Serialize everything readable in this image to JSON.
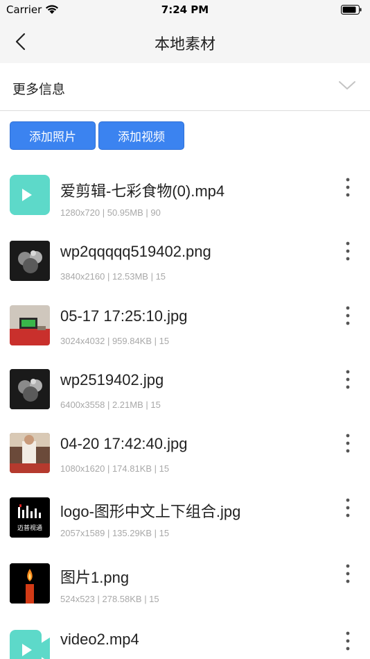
{
  "status_bar": {
    "carrier": "Carrier",
    "time": "7:24 PM"
  },
  "nav": {
    "title": "本地素材",
    "back_icon": "chevron-left-icon"
  },
  "more_info": {
    "label": "更多信息",
    "icon": "chevron-down-icon"
  },
  "actions": {
    "add_photo": "添加照片",
    "add_video": "添加视频"
  },
  "colors": {
    "accent": "#3b83f0",
    "video_thumb": "#5dd9c9",
    "meta_text": "#a8a8a8"
  },
  "items": [
    {
      "name": "爱剪辑-七彩食物(0).mp4",
      "meta": "1280x720 | 50.95MB | 90",
      "thumb": "video-icon"
    },
    {
      "name": "wp2qqqqq519402.png",
      "meta": "3840x2160 | 12.53MB | 15",
      "thumb": "image-thumbnail"
    },
    {
      "name": "05-17 17:25:10.jpg",
      "meta": "3024x4032 | 959.84KB | 15",
      "thumb": "image-thumbnail"
    },
    {
      "name": "wp2519402.jpg",
      "meta": "6400x3558 | 2.21MB | 15",
      "thumb": "image-thumbnail"
    },
    {
      "name": "04-20 17:42:40.jpg",
      "meta": "1080x1620 | 174.81KB | 15",
      "thumb": "image-thumbnail"
    },
    {
      "name": "logo-图形中文上下组合.jpg",
      "meta": "2057x1589 | 135.29KB | 15",
      "thumb": "image-thumbnail",
      "thumb_text": "迈普视通"
    },
    {
      "name": "图片1.png",
      "meta": "524x523 | 278.58KB | 15",
      "thumb": "image-thumbnail"
    },
    {
      "name": "video2.mp4",
      "meta": "",
      "thumb": "video-icon"
    }
  ]
}
